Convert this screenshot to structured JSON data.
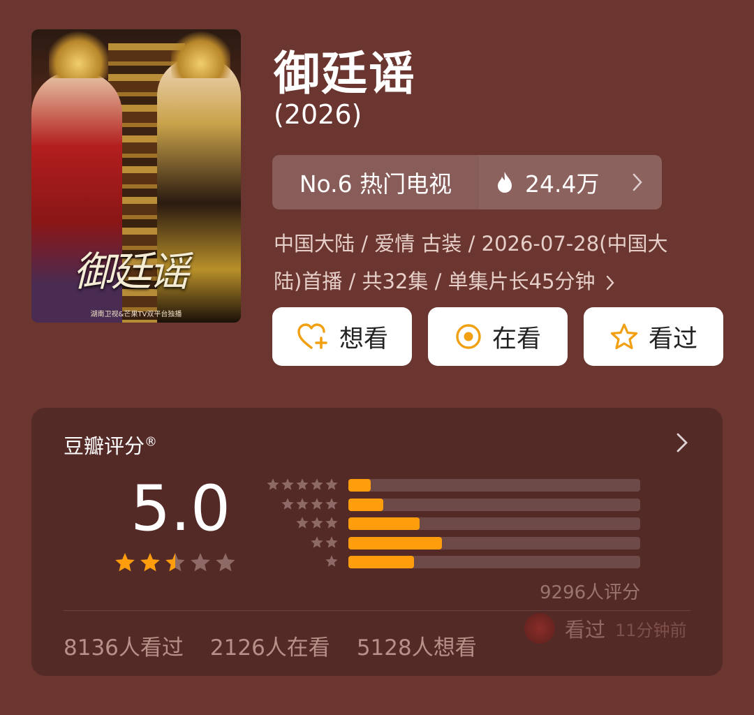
{
  "poster": {
    "title_art": "御廷谣",
    "footer": "湖南卫视&芒果TV双平台独播"
  },
  "title": "御廷谣",
  "year": "(2026)",
  "rank": {
    "label": "No.6 热门电视",
    "heat": "24.4万"
  },
  "meta": {
    "line1": "中国大陆 / 爱情 古装 / 2026-07-28(中国大",
    "line2": "陆)首播 / 共32集 / 单集片长45分钟"
  },
  "actions": {
    "want": "想看",
    "watching": "在看",
    "watched": "看过"
  },
  "rating": {
    "heading": "豆瓣评分",
    "heading_mark": "®",
    "score": "5.0",
    "score_stars": 2.5,
    "distribution": [
      {
        "stars": 5,
        "fraction": 0.076
      },
      {
        "stars": 4,
        "fraction": 0.12
      },
      {
        "stars": 3,
        "fraction": 0.245
      },
      {
        "stars": 2,
        "fraction": 0.32
      },
      {
        "stars": 1,
        "fraction": 0.226
      }
    ],
    "count": "9296人评分"
  },
  "stats": {
    "watched": "8136人看过",
    "watching": "2126人在看",
    "want": "5128人想看"
  },
  "activity": {
    "label": "看过",
    "time": "11分钟前"
  },
  "colors": {
    "background": "#6b3530",
    "card": "#542a27",
    "accent": "#ff9d0c",
    "action_icon": "#f0a010"
  }
}
